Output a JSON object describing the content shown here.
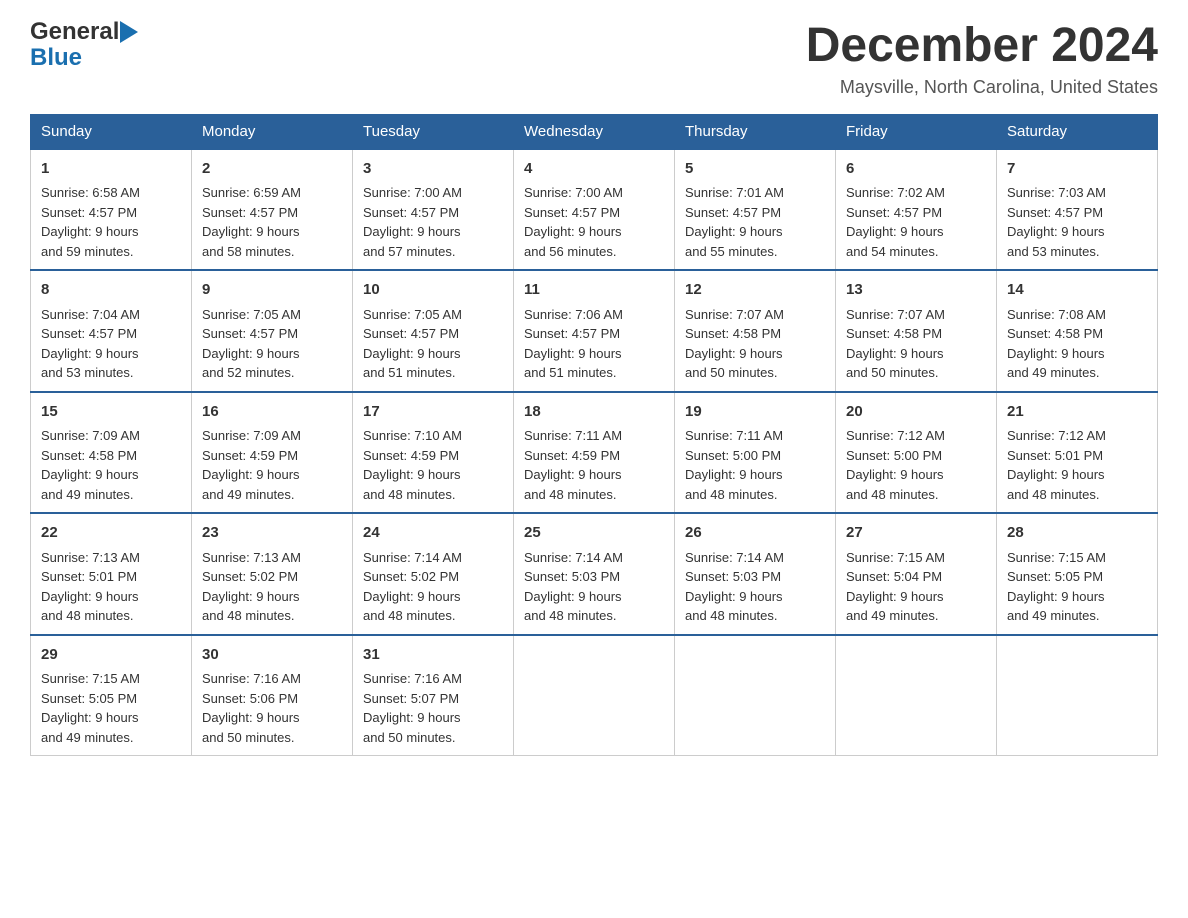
{
  "logo": {
    "general": "General",
    "blue": "Blue",
    "arrow": "▶"
  },
  "title": "December 2024",
  "location": "Maysville, North Carolina, United States",
  "weekdays": [
    "Sunday",
    "Monday",
    "Tuesday",
    "Wednesday",
    "Thursday",
    "Friday",
    "Saturday"
  ],
  "weeks": [
    [
      {
        "day": "1",
        "sunrise": "Sunrise: 6:58 AM",
        "sunset": "Sunset: 4:57 PM",
        "daylight": "Daylight: 9 hours",
        "daylight2": "and 59 minutes."
      },
      {
        "day": "2",
        "sunrise": "Sunrise: 6:59 AM",
        "sunset": "Sunset: 4:57 PM",
        "daylight": "Daylight: 9 hours",
        "daylight2": "and 58 minutes."
      },
      {
        "day": "3",
        "sunrise": "Sunrise: 7:00 AM",
        "sunset": "Sunset: 4:57 PM",
        "daylight": "Daylight: 9 hours",
        "daylight2": "and 57 minutes."
      },
      {
        "day": "4",
        "sunrise": "Sunrise: 7:00 AM",
        "sunset": "Sunset: 4:57 PM",
        "daylight": "Daylight: 9 hours",
        "daylight2": "and 56 minutes."
      },
      {
        "day": "5",
        "sunrise": "Sunrise: 7:01 AM",
        "sunset": "Sunset: 4:57 PM",
        "daylight": "Daylight: 9 hours",
        "daylight2": "and 55 minutes."
      },
      {
        "day": "6",
        "sunrise": "Sunrise: 7:02 AM",
        "sunset": "Sunset: 4:57 PM",
        "daylight": "Daylight: 9 hours",
        "daylight2": "and 54 minutes."
      },
      {
        "day": "7",
        "sunrise": "Sunrise: 7:03 AM",
        "sunset": "Sunset: 4:57 PM",
        "daylight": "Daylight: 9 hours",
        "daylight2": "and 53 minutes."
      }
    ],
    [
      {
        "day": "8",
        "sunrise": "Sunrise: 7:04 AM",
        "sunset": "Sunset: 4:57 PM",
        "daylight": "Daylight: 9 hours",
        "daylight2": "and 53 minutes."
      },
      {
        "day": "9",
        "sunrise": "Sunrise: 7:05 AM",
        "sunset": "Sunset: 4:57 PM",
        "daylight": "Daylight: 9 hours",
        "daylight2": "and 52 minutes."
      },
      {
        "day": "10",
        "sunrise": "Sunrise: 7:05 AM",
        "sunset": "Sunset: 4:57 PM",
        "daylight": "Daylight: 9 hours",
        "daylight2": "and 51 minutes."
      },
      {
        "day": "11",
        "sunrise": "Sunrise: 7:06 AM",
        "sunset": "Sunset: 4:57 PM",
        "daylight": "Daylight: 9 hours",
        "daylight2": "and 51 minutes."
      },
      {
        "day": "12",
        "sunrise": "Sunrise: 7:07 AM",
        "sunset": "Sunset: 4:58 PM",
        "daylight": "Daylight: 9 hours",
        "daylight2": "and 50 minutes."
      },
      {
        "day": "13",
        "sunrise": "Sunrise: 7:07 AM",
        "sunset": "Sunset: 4:58 PM",
        "daylight": "Daylight: 9 hours",
        "daylight2": "and 50 minutes."
      },
      {
        "day": "14",
        "sunrise": "Sunrise: 7:08 AM",
        "sunset": "Sunset: 4:58 PM",
        "daylight": "Daylight: 9 hours",
        "daylight2": "and 49 minutes."
      }
    ],
    [
      {
        "day": "15",
        "sunrise": "Sunrise: 7:09 AM",
        "sunset": "Sunset: 4:58 PM",
        "daylight": "Daylight: 9 hours",
        "daylight2": "and 49 minutes."
      },
      {
        "day": "16",
        "sunrise": "Sunrise: 7:09 AM",
        "sunset": "Sunset: 4:59 PM",
        "daylight": "Daylight: 9 hours",
        "daylight2": "and 49 minutes."
      },
      {
        "day": "17",
        "sunrise": "Sunrise: 7:10 AM",
        "sunset": "Sunset: 4:59 PM",
        "daylight": "Daylight: 9 hours",
        "daylight2": "and 48 minutes."
      },
      {
        "day": "18",
        "sunrise": "Sunrise: 7:11 AM",
        "sunset": "Sunset: 4:59 PM",
        "daylight": "Daylight: 9 hours",
        "daylight2": "and 48 minutes."
      },
      {
        "day": "19",
        "sunrise": "Sunrise: 7:11 AM",
        "sunset": "Sunset: 5:00 PM",
        "daylight": "Daylight: 9 hours",
        "daylight2": "and 48 minutes."
      },
      {
        "day": "20",
        "sunrise": "Sunrise: 7:12 AM",
        "sunset": "Sunset: 5:00 PM",
        "daylight": "Daylight: 9 hours",
        "daylight2": "and 48 minutes."
      },
      {
        "day": "21",
        "sunrise": "Sunrise: 7:12 AM",
        "sunset": "Sunset: 5:01 PM",
        "daylight": "Daylight: 9 hours",
        "daylight2": "and 48 minutes."
      }
    ],
    [
      {
        "day": "22",
        "sunrise": "Sunrise: 7:13 AM",
        "sunset": "Sunset: 5:01 PM",
        "daylight": "Daylight: 9 hours",
        "daylight2": "and 48 minutes."
      },
      {
        "day": "23",
        "sunrise": "Sunrise: 7:13 AM",
        "sunset": "Sunset: 5:02 PM",
        "daylight": "Daylight: 9 hours",
        "daylight2": "and 48 minutes."
      },
      {
        "day": "24",
        "sunrise": "Sunrise: 7:14 AM",
        "sunset": "Sunset: 5:02 PM",
        "daylight": "Daylight: 9 hours",
        "daylight2": "and 48 minutes."
      },
      {
        "day": "25",
        "sunrise": "Sunrise: 7:14 AM",
        "sunset": "Sunset: 5:03 PM",
        "daylight": "Daylight: 9 hours",
        "daylight2": "and 48 minutes."
      },
      {
        "day": "26",
        "sunrise": "Sunrise: 7:14 AM",
        "sunset": "Sunset: 5:03 PM",
        "daylight": "Daylight: 9 hours",
        "daylight2": "and 48 minutes."
      },
      {
        "day": "27",
        "sunrise": "Sunrise: 7:15 AM",
        "sunset": "Sunset: 5:04 PM",
        "daylight": "Daylight: 9 hours",
        "daylight2": "and 49 minutes."
      },
      {
        "day": "28",
        "sunrise": "Sunrise: 7:15 AM",
        "sunset": "Sunset: 5:05 PM",
        "daylight": "Daylight: 9 hours",
        "daylight2": "and 49 minutes."
      }
    ],
    [
      {
        "day": "29",
        "sunrise": "Sunrise: 7:15 AM",
        "sunset": "Sunset: 5:05 PM",
        "daylight": "Daylight: 9 hours",
        "daylight2": "and 49 minutes."
      },
      {
        "day": "30",
        "sunrise": "Sunrise: 7:16 AM",
        "sunset": "Sunset: 5:06 PM",
        "daylight": "Daylight: 9 hours",
        "daylight2": "and 50 minutes."
      },
      {
        "day": "31",
        "sunrise": "Sunrise: 7:16 AM",
        "sunset": "Sunset: 5:07 PM",
        "daylight": "Daylight: 9 hours",
        "daylight2": "and 50 minutes."
      },
      null,
      null,
      null,
      null
    ]
  ],
  "colors": {
    "header_bg": "#2a6099",
    "header_text": "#ffffff",
    "border_top": "#2a6099",
    "cell_border": "#cccccc"
  }
}
